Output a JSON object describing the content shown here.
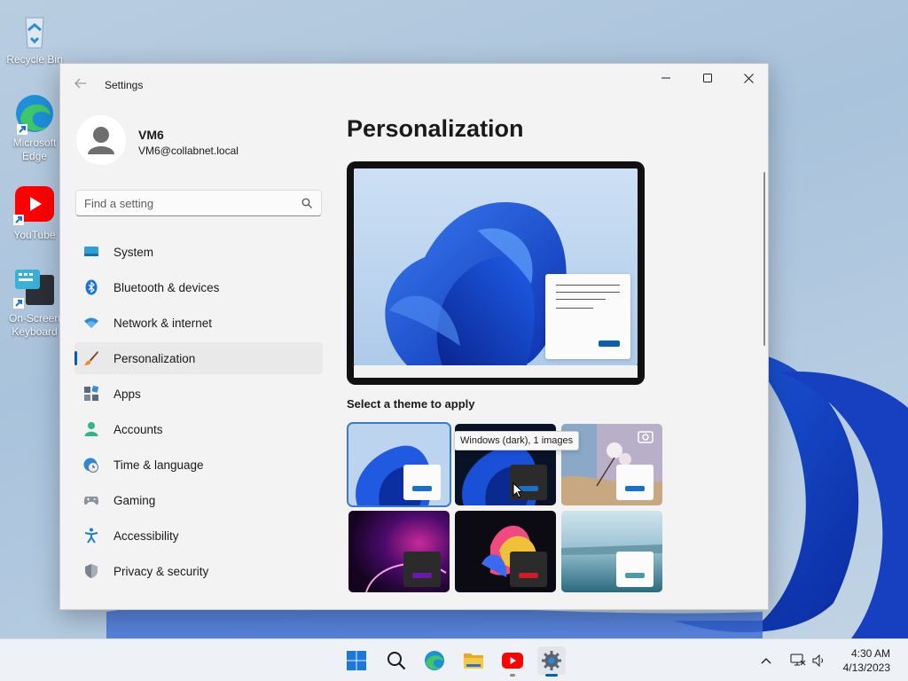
{
  "desktop": {
    "icons": [
      {
        "label": "Recycle Bin",
        "icon": "recycle-bin-icon"
      },
      {
        "label": "Microsoft Edge",
        "icon": "edge-icon"
      },
      {
        "label": "YouTube",
        "icon": "youtube-icon"
      },
      {
        "label": "On-Screen Keyboard",
        "icon": "keyboard-icon"
      }
    ]
  },
  "window": {
    "title": "Settings",
    "controls": {
      "minimize": "minimize-icon",
      "maximize": "maximize-icon",
      "close": "close-icon"
    }
  },
  "profile": {
    "name": "VM6",
    "email": "VM6@collabnet.local"
  },
  "search": {
    "placeholder": "Find a setting",
    "value": ""
  },
  "sidebar": {
    "items": [
      {
        "label": "System",
        "icon": "system-icon"
      },
      {
        "label": "Bluetooth & devices",
        "icon": "bluetooth-icon"
      },
      {
        "label": "Network & internet",
        "icon": "wifi-icon"
      },
      {
        "label": "Personalization",
        "icon": "brush-icon",
        "active": true
      },
      {
        "label": "Apps",
        "icon": "apps-icon"
      },
      {
        "label": "Accounts",
        "icon": "accounts-icon"
      },
      {
        "label": "Time & language",
        "icon": "clock-globe-icon"
      },
      {
        "label": "Gaming",
        "icon": "gamepad-icon"
      },
      {
        "label": "Accessibility",
        "icon": "accessibility-icon"
      },
      {
        "label": "Privacy & security",
        "icon": "shield-icon"
      }
    ]
  },
  "main": {
    "title": "Personalization",
    "themes_label": "Select a theme to apply",
    "tooltip": "Windows (dark), 1 images",
    "themes": [
      {
        "id": "windows-light",
        "selected": true,
        "accent": "#1b6fc4"
      },
      {
        "id": "windows-dark",
        "selected": false,
        "accent": "#1b6fc4"
      },
      {
        "id": "glow-captured-motion",
        "selected": false,
        "accent": "#1b6fc4"
      },
      {
        "id": "glow",
        "selected": false,
        "accent": "#6b1aa8"
      },
      {
        "id": "captured-motion",
        "selected": false,
        "accent": "#d21a2a"
      },
      {
        "id": "flow",
        "selected": false,
        "accent": "#4a9aa8"
      }
    ]
  },
  "taskbar": {
    "apps": [
      "start-icon",
      "search-icon",
      "edge-icon",
      "file-explorer-icon",
      "youtube-icon",
      "settings-icon"
    ],
    "time": "4:30 AM",
    "date": "4/13/2023"
  },
  "colors": {
    "accent": "#005fb8",
    "window_bg": "#f3f3f3"
  }
}
